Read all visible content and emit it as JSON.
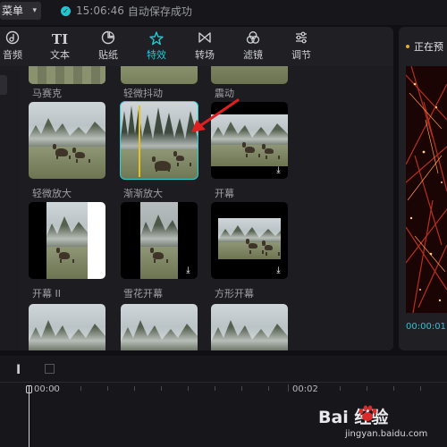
{
  "topbar": {
    "menu_label": "菜单",
    "menu_chevron": "chevron-down-icon",
    "save_time": "15:06:46",
    "save_status": "自动保存成功"
  },
  "tabs": [
    {
      "label": "音频",
      "icon": "audio-icon",
      "active": false
    },
    {
      "label": "文本",
      "icon": "text-icon",
      "active": false
    },
    {
      "label": "贴纸",
      "icon": "sticker-icon",
      "active": false
    },
    {
      "label": "特效",
      "icon": "effects-icon",
      "active": true
    },
    {
      "label": "转场",
      "icon": "transition-icon",
      "active": false
    },
    {
      "label": "滤镜",
      "icon": "filter-icon",
      "active": false
    },
    {
      "label": "调节",
      "icon": "adjust-icon",
      "active": false
    }
  ],
  "effects": {
    "row0": [
      "马赛克",
      "轻微抖动",
      "震动"
    ],
    "row1": [
      "轻微放大",
      "渐渐放大",
      "开幕"
    ],
    "row2": [
      "开幕 II",
      "雪花开幕",
      "方形开幕"
    ],
    "selected": "渐渐放大"
  },
  "preview": {
    "label": "正在预",
    "time": "00:00:01"
  },
  "timeline": {
    "ruler_start": "00:00",
    "ruler_mid": "00:02"
  },
  "watermark": {
    "main": "Bai 经验",
    "sub": "jingyan.baidu.com"
  },
  "colors": {
    "accent": "#21c8d3",
    "selection_outline": "#2ad0d8",
    "arrow": "#e02020",
    "split_line": "#e4c21f"
  }
}
